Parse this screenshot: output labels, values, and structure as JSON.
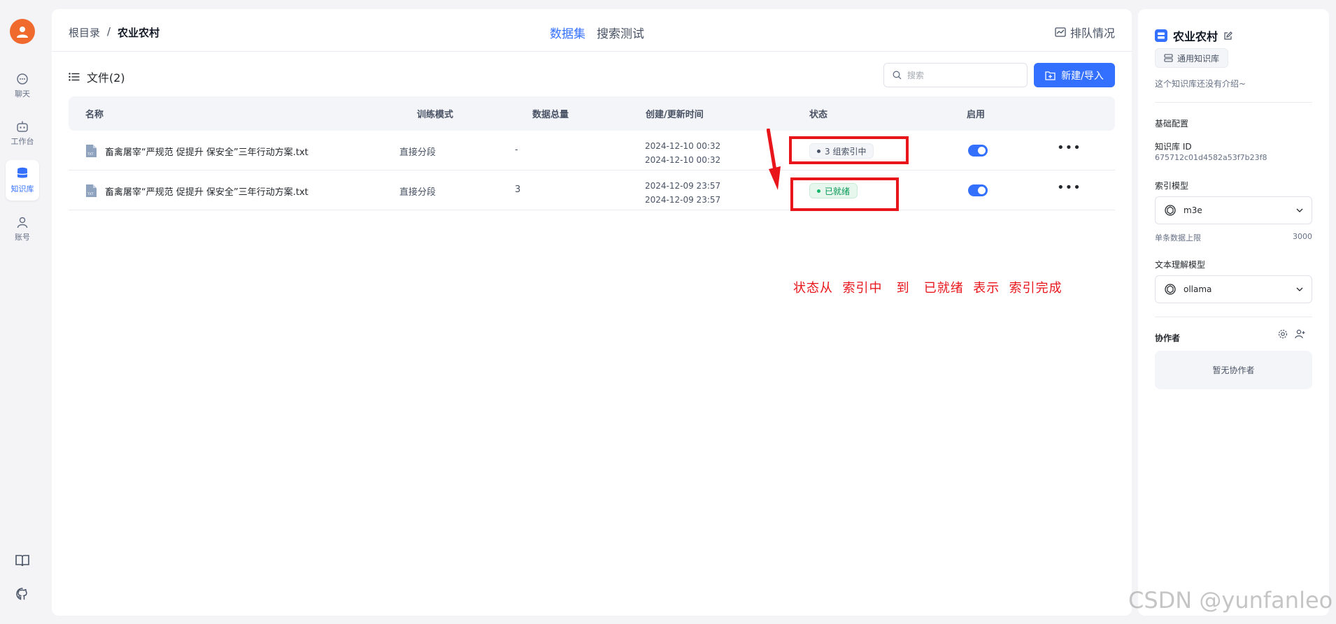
{
  "nav": {
    "items": [
      {
        "label": "聊天",
        "icon": "chat-icon"
      },
      {
        "label": "工作台",
        "icon": "robot-icon"
      },
      {
        "label": "知识库",
        "icon": "database-icon"
      },
      {
        "label": "账号",
        "icon": "user-icon"
      }
    ],
    "bottom": [
      {
        "icon": "book-icon"
      },
      {
        "icon": "github-icon"
      }
    ]
  },
  "breadcrumb": {
    "root": "根目录",
    "sep": "/",
    "current": "农业农村"
  },
  "tabs": {
    "dataset": "数据集",
    "search_test": "搜索测试"
  },
  "queue_label": "排队情况",
  "files": {
    "title": "文件(2)"
  },
  "search": {
    "placeholder": "搜索"
  },
  "new_button": "新建/导入",
  "table": {
    "headers": {
      "name": "名称",
      "mode": "训练模式",
      "count": "数据总量",
      "time": "创建/更新时间",
      "status": "状态",
      "enabled": "启用"
    },
    "rows": [
      {
        "name": "畜禽屠宰“严规范 促提升 保安全”三年行动方案.txt",
        "mode": "直接分段",
        "count": "-",
        "created": "2024-12-10 00:32",
        "updated": "2024-12-10 00:32",
        "status": "3 组索引中",
        "more": "•••"
      },
      {
        "name": "畜禽屠宰“严规范 促提升 保安全”三年行动方案.txt",
        "mode": "直接分段",
        "count": "3",
        "created": "2024-12-09 23:57",
        "updated": "2024-12-09 23:57",
        "status": "已就绪",
        "more": "•••"
      }
    ]
  },
  "annotation": "状态从  索引中   到   已就绪  表示  索引完成",
  "right": {
    "kb_name": "农业农村",
    "kb_type": "通用知识库",
    "intro": "这个知识库还没有介绍~",
    "basic_config": "基础配置",
    "kb_id_label": "知识库 ID",
    "kb_id": "675712c01d4582a53f7b23f8",
    "index_model_label": "索引模型",
    "index_model": "m3e",
    "max_data_label": "单条数据上限",
    "max_data": "3000",
    "text_model_label": "文本理解模型",
    "text_model": "ollama",
    "collaborators_label": "协作者",
    "no_collaborators": "暂无协作者"
  },
  "watermark": "CSDN @yunfanleo",
  "colors": {
    "accent": "#3370ff",
    "annotation_red": "#e8161b",
    "avatar": "#f06a2e"
  }
}
